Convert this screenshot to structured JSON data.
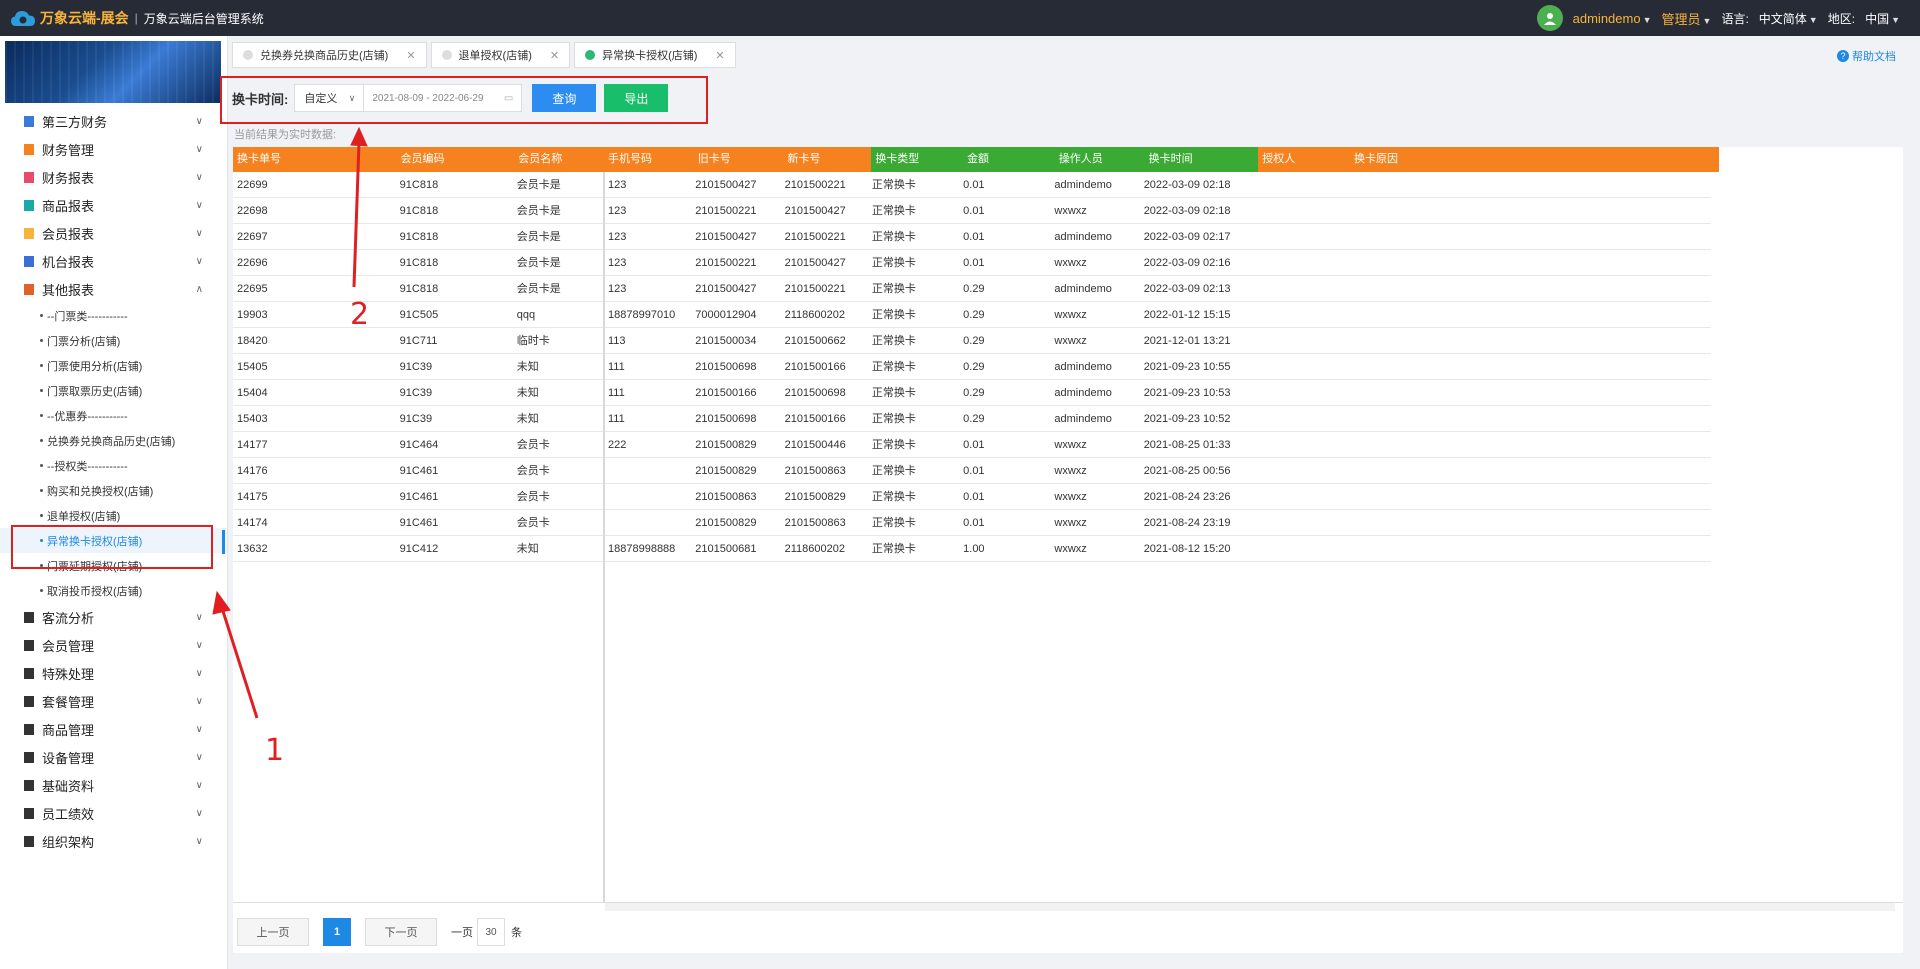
{
  "header": {
    "brand": "万象云端-展会",
    "separator": "|",
    "system_name": "万象云端后台管理系统",
    "user": "admindemo",
    "role": "管理员",
    "language_label": "语言:",
    "language_value": "中文简体",
    "region_label": "地区:",
    "region_value": "中国"
  },
  "sidebar": {
    "menu_top": [
      {
        "label": "第三方财务",
        "icon_color": "#3a7bd5"
      },
      {
        "label": "财务管理",
        "icon_color": "#f5821f"
      },
      {
        "label": "财务报表",
        "icon_color": "#e74c6c"
      },
      {
        "label": "商品报表",
        "icon_color": "#19a9a9"
      },
      {
        "label": "会员报表",
        "icon_color": "#f7b33a"
      },
      {
        "label": "机台报表",
        "icon_color": "#3a6fd8"
      },
      {
        "label": "其他报表",
        "icon_color": "#e0622a"
      }
    ],
    "sub_items": [
      "--门票类-----------",
      "门票分析(店铺)",
      "门票使用分析(店铺)",
      "门票取票历史(店铺)",
      "--优惠券-----------",
      "兑换券兑换商品历史(店铺)",
      "--授权类-----------",
      "购买和兑换授权(店铺)",
      "退单授权(店铺)",
      "异常换卡授权(店铺)",
      "门票延期授权(店铺)",
      "取消投币授权(店铺)"
    ],
    "active_sub_index": 9,
    "menu_bottom": [
      {
        "label": "客流分析",
        "icon_color": "#333"
      },
      {
        "label": "会员管理",
        "icon_color": "#333"
      },
      {
        "label": "特殊处理",
        "icon_color": "#333"
      },
      {
        "label": "套餐管理",
        "icon_color": "#333"
      },
      {
        "label": "商品管理",
        "icon_color": "#333"
      },
      {
        "label": "设备管理",
        "icon_color": "#333"
      },
      {
        "label": "基础资料",
        "icon_color": "#333"
      },
      {
        "label": "员工绩效",
        "icon_color": "#333"
      },
      {
        "label": "组织架构",
        "icon_color": "#333"
      }
    ]
  },
  "tabs": [
    {
      "label": "兑换券兑换商品历史(店铺)",
      "active": false
    },
    {
      "label": "退单授权(店铺)",
      "active": false
    },
    {
      "label": "异常换卡授权(店铺)",
      "active": true
    }
  ],
  "help_label": "帮助文档",
  "filter": {
    "label": "换卡时间:",
    "mode": "自定义",
    "date_range": "2021-08-09 - 2022-06-29",
    "query_label": "查询",
    "export_label": "导出"
  },
  "note": "当前结果为实时数据:",
  "table": {
    "columns": [
      "换卡单号",
      "会员编码",
      "会员名称",
      "手机号码",
      "旧卡号",
      "新卡号",
      "换卡类型",
      "金额",
      "操作人员",
      "换卡时间",
      "授权人",
      "换卡原因"
    ],
    "rows": [
      [
        "22699",
        "91C818",
        "会员卡是",
        "123",
        "2101500427",
        "2101500221",
        "正常换卡",
        "0.01",
        "admindemo",
        "2022-03-09 02:18",
        "",
        ""
      ],
      [
        "22698",
        "91C818",
        "会员卡是",
        "123",
        "2101500221",
        "2101500427",
        "正常换卡",
        "0.01",
        "wxwxz",
        "2022-03-09 02:18",
        "",
        ""
      ],
      [
        "22697",
        "91C818",
        "会员卡是",
        "123",
        "2101500427",
        "2101500221",
        "正常换卡",
        "0.01",
        "admindemo",
        "2022-03-09 02:17",
        "",
        ""
      ],
      [
        "22696",
        "91C818",
        "会员卡是",
        "123",
        "2101500221",
        "2101500427",
        "正常换卡",
        "0.01",
        "wxwxz",
        "2022-03-09 02:16",
        "",
        ""
      ],
      [
        "22695",
        "91C818",
        "会员卡是",
        "123",
        "2101500427",
        "2101500221",
        "正常换卡",
        "0.29",
        "admindemo",
        "2022-03-09 02:13",
        "",
        ""
      ],
      [
        "19903",
        "91C505",
        "qqq",
        "18878997010",
        "7000012904",
        "2118600202",
        "正常换卡",
        "0.29",
        "wxwxz",
        "2022-01-12 15:15",
        "",
        ""
      ],
      [
        "18420",
        "91C711",
        "临时卡",
        "113",
        "2101500034",
        "2101500662",
        "正常换卡",
        "0.29",
        "wxwxz",
        "2021-12-01 13:21",
        "",
        ""
      ],
      [
        "15405",
        "91C39",
        "未知",
        "111",
        "2101500698",
        "2101500166",
        "正常换卡",
        "0.29",
        "admindemo",
        "2021-09-23 10:55",
        "",
        ""
      ],
      [
        "15404",
        "91C39",
        "未知",
        "111",
        "2101500166",
        "2101500698",
        "正常换卡",
        "0.29",
        "admindemo",
        "2021-09-23 10:53",
        "",
        ""
      ],
      [
        "15403",
        "91C39",
        "未知",
        "111",
        "2101500698",
        "2101500166",
        "正常换卡",
        "0.29",
        "admindemo",
        "2021-09-23 10:52",
        "",
        ""
      ],
      [
        "14177",
        "91C464",
        "会员卡",
        "222",
        "2101500829",
        "2101500446",
        "正常换卡",
        "0.01",
        "wxwxz",
        "2021-08-25 01:33",
        "",
        ""
      ],
      [
        "14176",
        "91C461",
        "会员卡",
        "",
        "2101500829",
        "2101500863",
        "正常换卡",
        "0.01",
        "wxwxz",
        "2021-08-25 00:56",
        "",
        ""
      ],
      [
        "14175",
        "91C461",
        "会员卡",
        "",
        "2101500863",
        "2101500829",
        "正常换卡",
        "0.01",
        "wxwxz",
        "2021-08-24 23:26",
        "",
        ""
      ],
      [
        "14174",
        "91C461",
        "会员卡",
        "",
        "2101500829",
        "2101500863",
        "正常换卡",
        "0.01",
        "wxwxz",
        "2021-08-24 23:19",
        "",
        ""
      ],
      [
        "13632",
        "91C412",
        "未知",
        "18878998888",
        "2101500681",
        "2118600202",
        "正常换卡",
        "1.00",
        "wxwxz",
        "2021-08-12 15:20",
        "",
        ""
      ]
    ]
  },
  "pager": {
    "prev_label": "上一页",
    "page": "1",
    "next_label": "下一页",
    "per_page_label": "一页",
    "page_size": "30",
    "unit": "条"
  },
  "annotations": {
    "label_1": "1",
    "label_2": "2",
    "color": "#e02020"
  }
}
